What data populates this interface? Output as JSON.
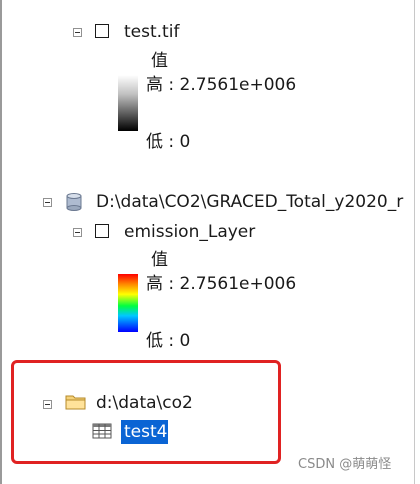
{
  "toc": {
    "layer1": {
      "name": "test.tif",
      "legend_header": "值",
      "high_label": "高 : 2.7561e+006",
      "low_label": "低 : 0"
    },
    "database": {
      "path": "D:\\data\\CO2\\GRACED_Total_y2020_r",
      "layer": {
        "name": "emission_Layer",
        "legend_header": "值",
        "high_label": "高 : 2.7561e+006",
        "low_label": "低 : 0"
      }
    },
    "folder": {
      "path": "d:\\data\\co2",
      "table": "test4"
    }
  },
  "watermark": "CSDN @萌萌怪",
  "colors": {
    "selection": "#0a64d4",
    "highlight_border": "#e02222"
  },
  "icons": {
    "database": "database-icon",
    "folder": "folder-icon",
    "table": "table-icon"
  }
}
